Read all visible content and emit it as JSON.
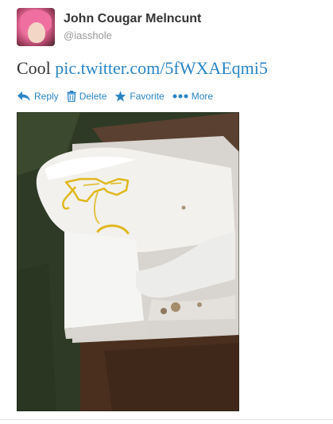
{
  "tweet": {
    "user": {
      "display_name": "John Cougar Melncunt",
      "handle": "@iasshole"
    },
    "text_prefix": "Cool ",
    "link_text": "pic.twitter.com/5fWXAEqmi5",
    "accent_color": "#2a85c6"
  },
  "actions": {
    "reply_label": "Reply",
    "delete_label": "Delete",
    "favorite_label": "Favorite",
    "more_label": "More"
  },
  "icons": [
    "reply-icon",
    "trash-icon",
    "star-icon",
    "more-dots-icon"
  ]
}
